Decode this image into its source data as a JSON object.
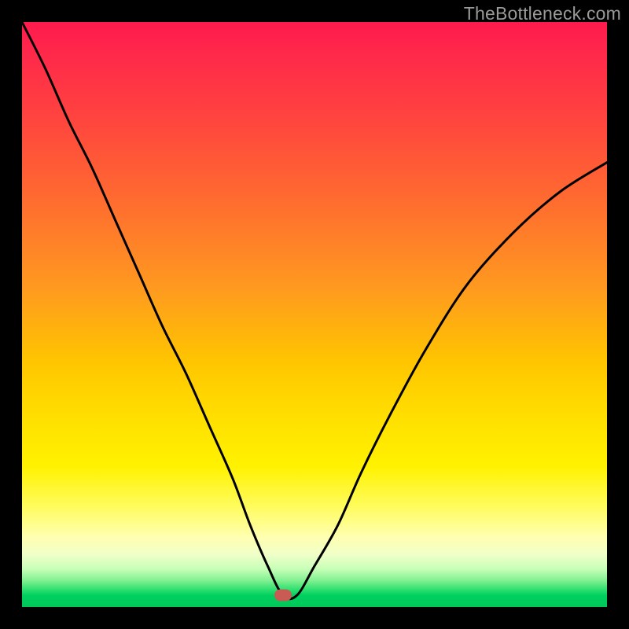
{
  "watermark": "TheBottleneck.com",
  "marker": {
    "x_pct": 44.6,
    "y_pct": 98.0,
    "color": "#c95b55"
  },
  "chart_data": {
    "type": "line",
    "title": "",
    "xlabel": "",
    "ylabel": "",
    "xlim": [
      0,
      100
    ],
    "ylim": [
      0,
      100
    ],
    "legend": false,
    "grid": false,
    "background": "rainbow-gradient (red top → green bottom)",
    "annotations": [
      {
        "type": "marker",
        "x": 44.6,
        "y": 2.0,
        "shape": "rounded-rect",
        "color": "#c95b55"
      }
    ],
    "series": [
      {
        "name": "bottleneck-curve",
        "x": [
          0,
          4,
          8,
          12,
          16,
          20,
          24,
          28,
          32,
          36,
          39,
          42,
          44.6,
          47,
          50,
          54,
          58,
          63,
          69,
          76,
          84,
          92,
          100
        ],
        "y": [
          100,
          92,
          83,
          75,
          66,
          57,
          48,
          40,
          31,
          22,
          14,
          7,
          2,
          2,
          7,
          14,
          23,
          33,
          44,
          55,
          64,
          71,
          76
        ]
      }
    ]
  }
}
